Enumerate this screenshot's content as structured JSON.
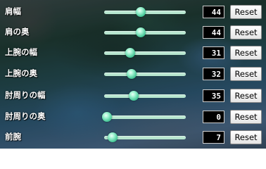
{
  "reset_label": "Reset",
  "slider_max": 100,
  "colors": {
    "track": "#b7e6cf",
    "knob": "#45c596",
    "value_box_bg": "#000000"
  },
  "sliders": [
    {
      "label": "肩幅",
      "value": "44"
    },
    {
      "label": "肩の奥",
      "value": "44"
    },
    {
      "label": "上腕の幅",
      "value": "31"
    },
    {
      "label": "上腕の奥",
      "value": "32"
    },
    {
      "label": "肘周りの幅",
      "value": "35"
    },
    {
      "label": "肘周りの奥",
      "value": "0"
    },
    {
      "label": "前腕",
      "value": "7"
    }
  ]
}
